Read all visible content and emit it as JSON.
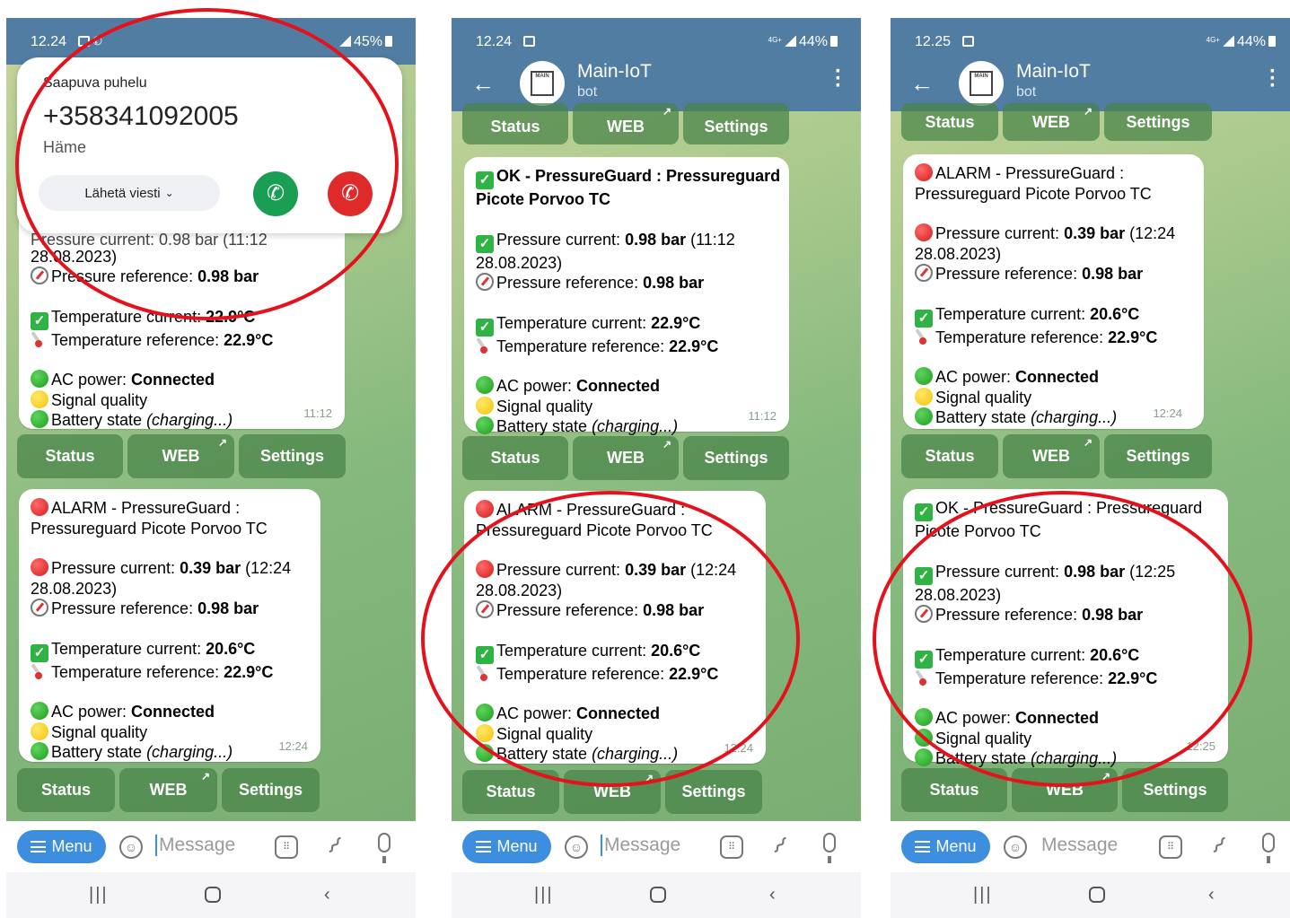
{
  "common": {
    "bot_name": "Main-IoT",
    "bot_sub": "bot",
    "avatar_text": "MAIN",
    "btn_status": "Status",
    "btn_web": "WEB",
    "btn_settings": "Settings",
    "menu": "Menu",
    "placeholder": "Message",
    "accent_color": "#527da3",
    "alert_ring_color": "#e4121c"
  },
  "msg": {
    "ok_title": "OK - PressureGuard : Pressureguard Picote Porvoo TC",
    "ok_title_l1": "OK - PressureGuard : Pressureguard",
    "ok_title_l2": "Picote Porvoo TC",
    "alarm_title_l1": "ALARM - PressureGuard :",
    "alarm_title_l2": "Pressureguard Picote Porvoo TC",
    "pc_label": "Pressure current: ",
    "pc_ok_1112": "0.98 bar",
    "pc_ok_1112_tail": " (11:12",
    "pc_alarm": "0.39 bar",
    "pc_alarm_tail": " (12:24",
    "pc_ok_1225": "0.98 bar",
    "pc_ok_1225_tail": " (12:25",
    "pc_date": "28.08.2023)",
    "pr_label": "Pressure reference: ",
    "pr_value": "0.98 bar",
    "tc_label": "Temperature current: ",
    "tc_ok": "22.9°C",
    "tc_alarm": "20.6°C",
    "tr_label": "Temperature reference: ",
    "tr_value": "22.9°C",
    "ac_label": "AC power: ",
    "ac_value": "Connected",
    "signal": "Signal quality",
    "batt_label": "Battery state ",
    "batt_value": "(charging...)",
    "time_1112": "11:12",
    "time_1224": "12:24",
    "time_1225": "12:25"
  },
  "screens": [
    {
      "time": "12.24",
      "battery": "45%",
      "call": {
        "label": "Saapuva puhelu",
        "number": "+358341092005",
        "location": "Häme",
        "reply": "Lähetä viesti"
      },
      "partial_line": "Pressure current: 0.98 bar (11:12"
    },
    {
      "time": "12.24",
      "battery": "44%",
      "net": "4G+"
    },
    {
      "time": "12.25",
      "battery": "44%",
      "net": "4G+"
    }
  ]
}
